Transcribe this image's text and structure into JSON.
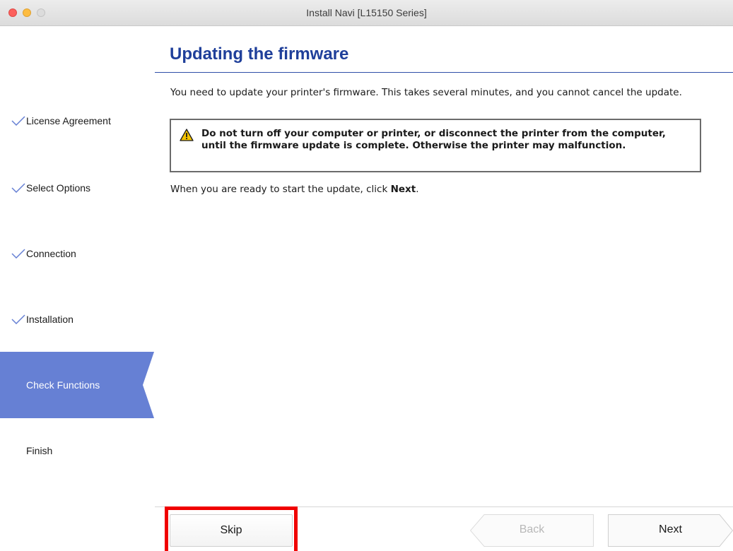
{
  "window": {
    "title": "Install Navi [L15150 Series]"
  },
  "sidebar": {
    "steps": [
      {
        "label": "License Agreement",
        "completed": true
      },
      {
        "label": "Select Options",
        "completed": true
      },
      {
        "label": "Connection",
        "completed": true
      },
      {
        "label": "Installation",
        "completed": true
      },
      {
        "label": "Check Functions",
        "active": true
      },
      {
        "label": "Finish",
        "completed": false
      }
    ],
    "active_color": "#6680d4",
    "check_color": "#6680d4"
  },
  "main": {
    "heading": "Updating the firmware",
    "intro": "You need to update your printer's firmware. This takes several minutes, and you cannot cancel the update.",
    "warning": "Do not turn off your computer or printer, or disconnect the printer from the computer, until the firmware update is complete. Otherwise the printer may malfunction.",
    "ready_prefix": "When you are ready to start the update, click ",
    "ready_bold": "Next",
    "ready_suffix": "."
  },
  "footer": {
    "skip_label": "Skip",
    "back_label": "Back",
    "next_label": "Next",
    "back_enabled": false,
    "skip_highlight_color": "#f00000"
  },
  "heading_color": "#1f3f9a"
}
